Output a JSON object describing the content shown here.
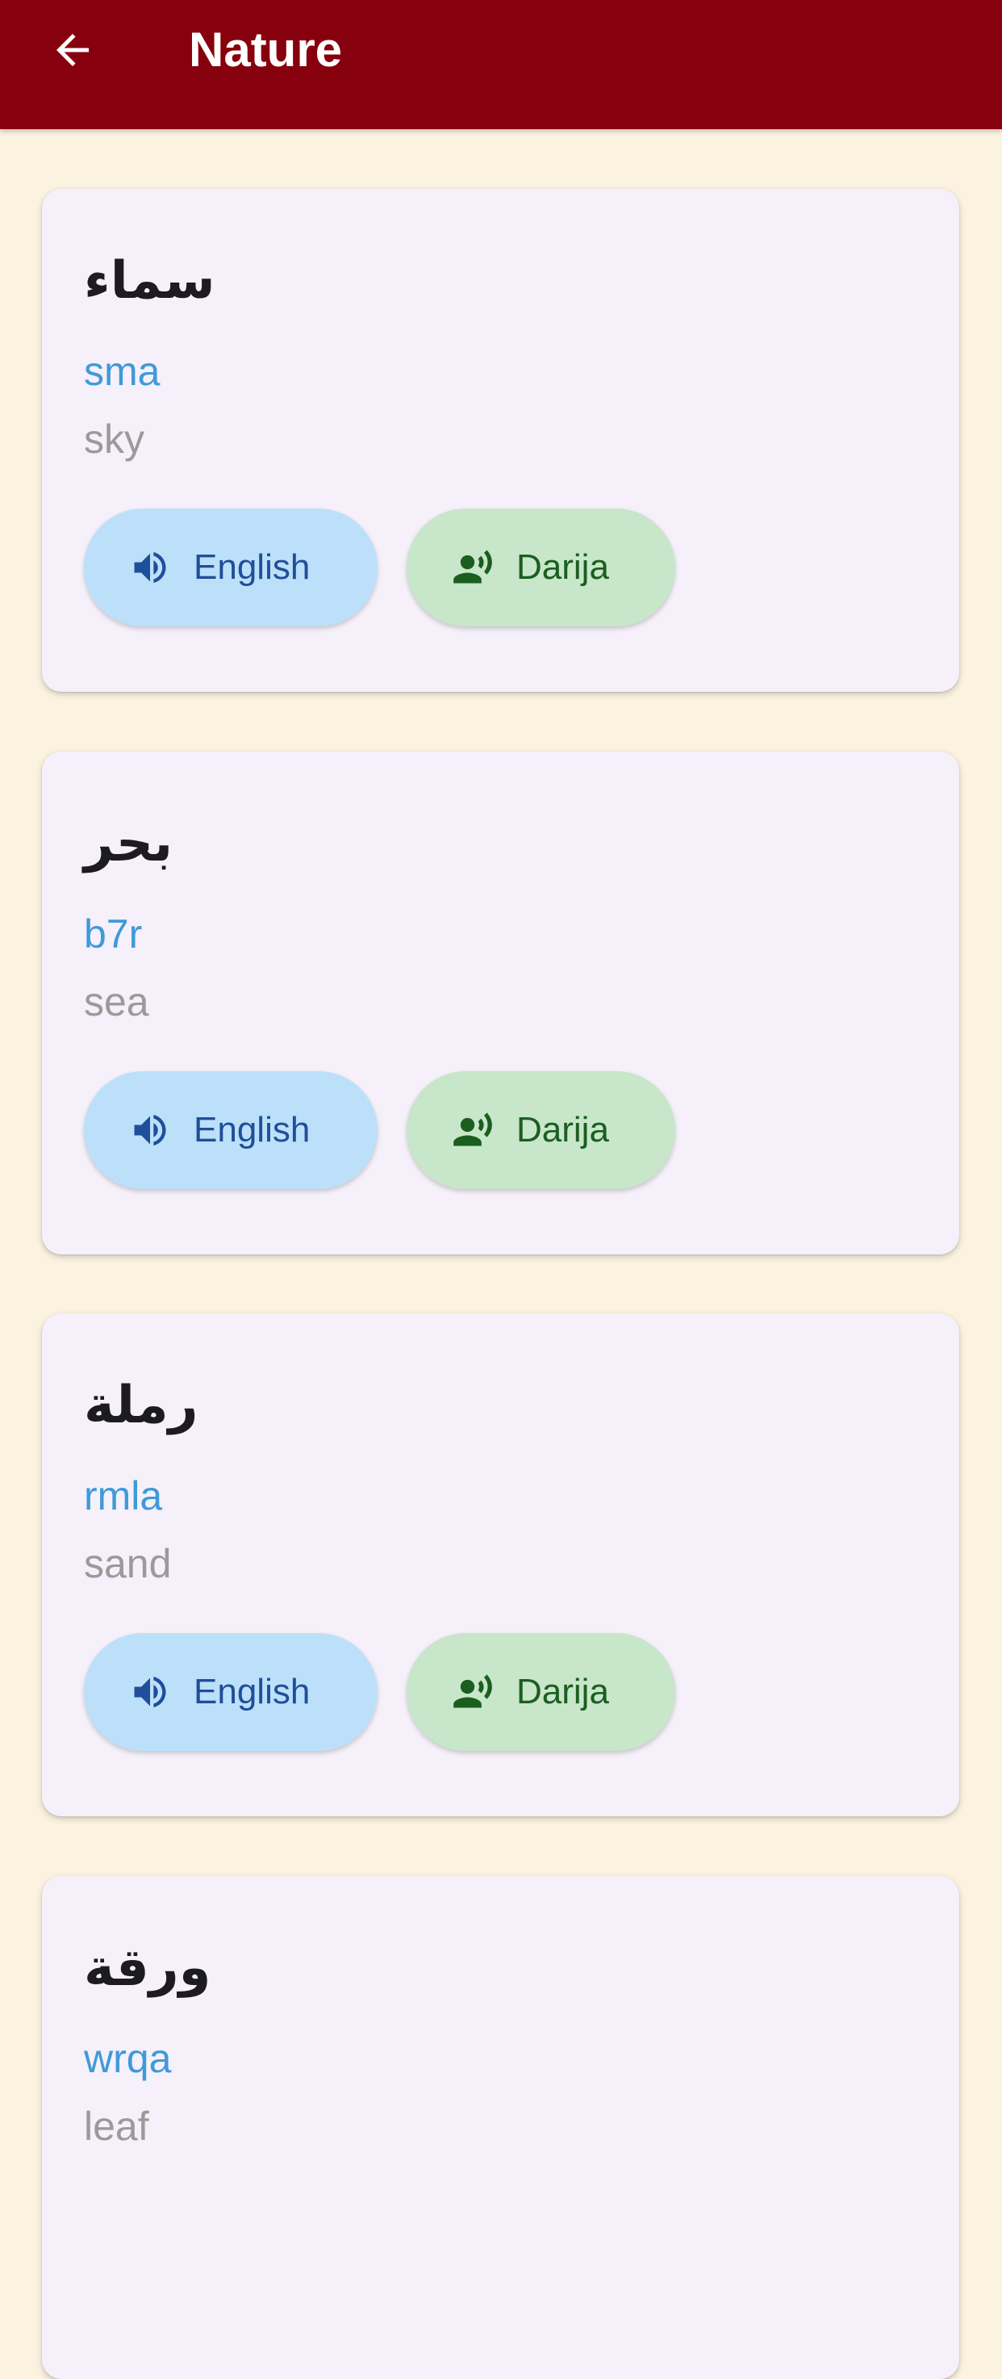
{
  "app_bar": {
    "title": "Nature",
    "back_icon": "arrow-left-icon",
    "background": "#87000d"
  },
  "buttons": {
    "english_label": "English",
    "darija_label": "Darija",
    "english_icon": "volume-up-icon",
    "darija_icon": "record-voice-icon",
    "english_color": "#bde0fa",
    "darija_color": "#c8e6c9"
  },
  "words": [
    {
      "arabic": "سماء",
      "translit": "sma",
      "meaning": "sky"
    },
    {
      "arabic": "بحر",
      "translit": "b7r",
      "meaning": "sea"
    },
    {
      "arabic": "رملة",
      "translit": "rmla",
      "meaning": "sand"
    },
    {
      "arabic": "ورقة",
      "translit": "wrqa",
      "meaning": "leaf"
    }
  ]
}
